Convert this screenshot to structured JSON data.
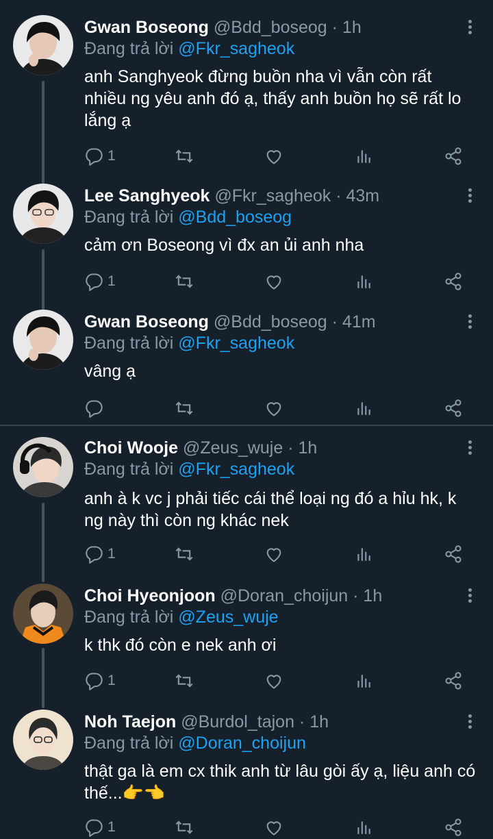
{
  "colors": {
    "background": "#15202b",
    "link": "#1da1f2",
    "muted": "#8899a6",
    "divider": "#38444d"
  },
  "reply_prefix": "Đang trả lời",
  "tweets": [
    {
      "name": "Gwan Boseong",
      "handle": "@Bdd_boseog · 1h",
      "reply_to": "@Fkr_sagheok",
      "text": "anh Sanghyeok đừng buồn nha vì vẫn còn rất nhiều ng yêu anh đó ạ, thấy anh buồn họ sẽ rất lo lắng ạ",
      "replies": "1"
    },
    {
      "name": "Lee Sanghyeok",
      "handle": "@Fkr_sagheok · 43m",
      "reply_to": "@Bdd_boseog",
      "text": "cảm ơn Boseong vì đx an ủi anh nha",
      "replies": "1"
    },
    {
      "name": "Gwan Boseong",
      "handle": "@Bdd_boseog · 41m",
      "reply_to": "@Fkr_sagheok",
      "text": "vâng ạ",
      "replies": ""
    },
    {
      "name": "Choi Wooje",
      "handle": "@Zeus_wuje · 1h",
      "reply_to": "@Fkr_sagheok",
      "text": "anh à k vc j phải tiếc cái thể loại ng đó a hỉu hk, k ng này thì còn ng khác nek",
      "replies": "1"
    },
    {
      "name": "Choi Hyeonjoon",
      "handle": "@Doran_choijun · 1h",
      "reply_to": "@Zeus_wuje",
      "text": "k thk đó còn e nek anh ơi",
      "replies": "1"
    },
    {
      "name": "Noh Taejon",
      "handle": "@Burdol_tajon · 1h",
      "reply_to": "@Doran_choijun",
      "text": "thật ga là em cx thik anh từ lâu gòi ấy ạ, liệu anh có thế...👉👈",
      "replies": "1"
    }
  ]
}
